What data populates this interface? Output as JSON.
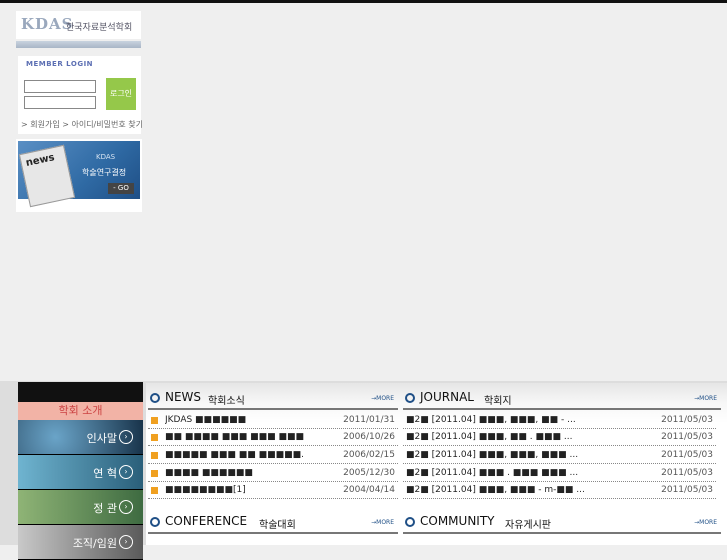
{
  "logo": {
    "mark": "KDAS",
    "name": "한국자료분석학회"
  },
  "login": {
    "title": "MEMBER LOGIN",
    "button": "로그인",
    "join_link": "> 회원가입",
    "find_link": "> 아이디/비밀번호 찾기"
  },
  "banner": {
    "paper_label": "news",
    "line1": "KDAS",
    "line2": "학술연구결정",
    "go": "- GO"
  },
  "menu": {
    "head": "학회 소개",
    "items": [
      {
        "label": "인사말"
      },
      {
        "label": "연 혁"
      },
      {
        "label": "정 관"
      },
      {
        "label": "조직/임원"
      }
    ]
  },
  "news": {
    "en": "NEWS",
    "ko": "학회소식",
    "more": "→MORE",
    "rows": [
      {
        "title": "JKDAS ■■■■■■",
        "date": "2011/01/31"
      },
      {
        "title": "■■ ■■■■ ■■■ ■■■ ■■■",
        "date": "2006/10/26"
      },
      {
        "title": "■■■■■ ■■■ ■■ ■■■■■.",
        "date": "2006/02/15"
      },
      {
        "title": "■■■■ ■■■■■■",
        "date": "2005/12/30"
      },
      {
        "title": "■■■■■■■■[1]",
        "date": "2004/04/14"
      }
    ]
  },
  "journal": {
    "en": "JOURNAL",
    "ko": "학회지",
    "more": "→MORE",
    "rows": [
      {
        "title": "■2■ [2011.04] ■■■, ■■■, ■■ - ...",
        "date": "2011/05/03"
      },
      {
        "title": "■2■ [2011.04] ■■■, ■■ . ■■■ ...",
        "date": "2011/05/03"
      },
      {
        "title": "■2■ [2011.04] ■■■, ■■■, ■■■ ...",
        "date": "2011/05/03"
      },
      {
        "title": "■2■ [2011.04] ■■■ . ■■■ ■■■ ...",
        "date": "2011/05/03"
      },
      {
        "title": "■2■ [2011.04] ■■■, ■■■ - m-■■ ...",
        "date": "2011/05/03"
      }
    ]
  },
  "conference": {
    "en": "CONFERENCE",
    "ko": "학술대회",
    "more": "→MORE"
  },
  "community": {
    "en": "COMMUNITY",
    "ko": "자유게시판",
    "more": "→MORE"
  }
}
